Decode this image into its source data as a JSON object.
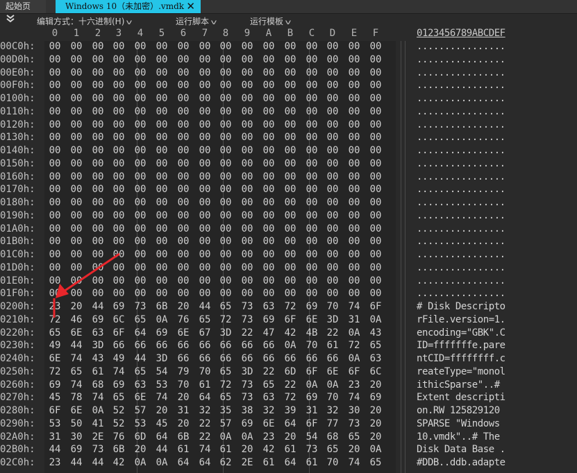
{
  "tabs": {
    "home_label": "起始页",
    "file_label": "Windows 10（未加密）.vmdk",
    "close_glyph": "✕"
  },
  "toolbar": {
    "edit_mode_label": "编辑方式：十六进制(H)",
    "run_script_label": "运行脚本",
    "run_template_label": "运行模板"
  },
  "columns": [
    "0",
    "1",
    "2",
    "3",
    "4",
    "5",
    "6",
    "7",
    "8",
    "9",
    "A",
    "B",
    "C",
    "D",
    "E",
    "F"
  ],
  "ascii_header": "0123456789ABCDEF",
  "rows": [
    {
      "offset": "00C0h:",
      "bytes": [
        "00",
        "00",
        "00",
        "00",
        "00",
        "00",
        "00",
        "00",
        "00",
        "00",
        "00",
        "00",
        "00",
        "00",
        "00",
        "00"
      ],
      "ascii": "................"
    },
    {
      "offset": "00D0h:",
      "bytes": [
        "00",
        "00",
        "00",
        "00",
        "00",
        "00",
        "00",
        "00",
        "00",
        "00",
        "00",
        "00",
        "00",
        "00",
        "00",
        "00"
      ],
      "ascii": "................"
    },
    {
      "offset": "00E0h:",
      "bytes": [
        "00",
        "00",
        "00",
        "00",
        "00",
        "00",
        "00",
        "00",
        "00",
        "00",
        "00",
        "00",
        "00",
        "00",
        "00",
        "00"
      ],
      "ascii": "................"
    },
    {
      "offset": "00F0h:",
      "bytes": [
        "00",
        "00",
        "00",
        "00",
        "00",
        "00",
        "00",
        "00",
        "00",
        "00",
        "00",
        "00",
        "00",
        "00",
        "00",
        "00"
      ],
      "ascii": "................"
    },
    {
      "offset": "0100h:",
      "bytes": [
        "00",
        "00",
        "00",
        "00",
        "00",
        "00",
        "00",
        "00",
        "00",
        "00",
        "00",
        "00",
        "00",
        "00",
        "00",
        "00"
      ],
      "ascii": "................"
    },
    {
      "offset": "0110h:",
      "bytes": [
        "00",
        "00",
        "00",
        "00",
        "00",
        "00",
        "00",
        "00",
        "00",
        "00",
        "00",
        "00",
        "00",
        "00",
        "00",
        "00"
      ],
      "ascii": "................"
    },
    {
      "offset": "0120h:",
      "bytes": [
        "00",
        "00",
        "00",
        "00",
        "00",
        "00",
        "00",
        "00",
        "00",
        "00",
        "00",
        "00",
        "00",
        "00",
        "00",
        "00"
      ],
      "ascii": "................"
    },
    {
      "offset": "0130h:",
      "bytes": [
        "00",
        "00",
        "00",
        "00",
        "00",
        "00",
        "00",
        "00",
        "00",
        "00",
        "00",
        "00",
        "00",
        "00",
        "00",
        "00"
      ],
      "ascii": "................"
    },
    {
      "offset": "0140h:",
      "bytes": [
        "00",
        "00",
        "00",
        "00",
        "00",
        "00",
        "00",
        "00",
        "00",
        "00",
        "00",
        "00",
        "00",
        "00",
        "00",
        "00"
      ],
      "ascii": "................"
    },
    {
      "offset": "0150h:",
      "bytes": [
        "00",
        "00",
        "00",
        "00",
        "00",
        "00",
        "00",
        "00",
        "00",
        "00",
        "00",
        "00",
        "00",
        "00",
        "00",
        "00"
      ],
      "ascii": "................"
    },
    {
      "offset": "0160h:",
      "bytes": [
        "00",
        "00",
        "00",
        "00",
        "00",
        "00",
        "00",
        "00",
        "00",
        "00",
        "00",
        "00",
        "00",
        "00",
        "00",
        "00"
      ],
      "ascii": "................"
    },
    {
      "offset": "0170h:",
      "bytes": [
        "00",
        "00",
        "00",
        "00",
        "00",
        "00",
        "00",
        "00",
        "00",
        "00",
        "00",
        "00",
        "00",
        "00",
        "00",
        "00"
      ],
      "ascii": "................"
    },
    {
      "offset": "0180h:",
      "bytes": [
        "00",
        "00",
        "00",
        "00",
        "00",
        "00",
        "00",
        "00",
        "00",
        "00",
        "00",
        "00",
        "00",
        "00",
        "00",
        "00"
      ],
      "ascii": "................"
    },
    {
      "offset": "0190h:",
      "bytes": [
        "00",
        "00",
        "00",
        "00",
        "00",
        "00",
        "00",
        "00",
        "00",
        "00",
        "00",
        "00",
        "00",
        "00",
        "00",
        "00"
      ],
      "ascii": "................"
    },
    {
      "offset": "01A0h:",
      "bytes": [
        "00",
        "00",
        "00",
        "00",
        "00",
        "00",
        "00",
        "00",
        "00",
        "00",
        "00",
        "00",
        "00",
        "00",
        "00",
        "00"
      ],
      "ascii": "................"
    },
    {
      "offset": "01B0h:",
      "bytes": [
        "00",
        "00",
        "00",
        "00",
        "00",
        "00",
        "00",
        "00",
        "00",
        "00",
        "00",
        "00",
        "00",
        "00",
        "00",
        "00"
      ],
      "ascii": "................"
    },
    {
      "offset": "01C0h:",
      "bytes": [
        "00",
        "00",
        "00",
        "00",
        "00",
        "00",
        "00",
        "00",
        "00",
        "00",
        "00",
        "00",
        "00",
        "00",
        "00",
        "00"
      ],
      "ascii": "................"
    },
    {
      "offset": "01D0h:",
      "bytes": [
        "00",
        "00",
        "00",
        "00",
        "00",
        "00",
        "00",
        "00",
        "00",
        "00",
        "00",
        "00",
        "00",
        "00",
        "00",
        "00"
      ],
      "ascii": "................"
    },
    {
      "offset": "01E0h:",
      "bytes": [
        "00",
        "00",
        "00",
        "00",
        "00",
        "00",
        "00",
        "00",
        "00",
        "00",
        "00",
        "00",
        "00",
        "00",
        "00",
        "00"
      ],
      "ascii": "................"
    },
    {
      "offset": "01F0h:",
      "bytes": [
        "00",
        "00",
        "00",
        "00",
        "00",
        "00",
        "00",
        "00",
        "00",
        "00",
        "00",
        "00",
        "00",
        "00",
        "00",
        "00"
      ],
      "ascii": "................"
    },
    {
      "offset": "0200h:",
      "bytes": [
        "23",
        "20",
        "44",
        "69",
        "73",
        "6B",
        "20",
        "44",
        "65",
        "73",
        "63",
        "72",
        "69",
        "70",
        "74",
        "6F"
      ],
      "ascii": "# Disk Descripto"
    },
    {
      "offset": "0210h:",
      "bytes": [
        "72",
        "46",
        "69",
        "6C",
        "65",
        "0A",
        "76",
        "65",
        "72",
        "73",
        "69",
        "6F",
        "6E",
        "3D",
        "31",
        "0A"
      ],
      "ascii": "rFile.version=1."
    },
    {
      "offset": "0220h:",
      "bytes": [
        "65",
        "6E",
        "63",
        "6F",
        "64",
        "69",
        "6E",
        "67",
        "3D",
        "22",
        "47",
        "42",
        "4B",
        "22",
        "0A",
        "43"
      ],
      "ascii": "encoding=\"GBK\".C"
    },
    {
      "offset": "0230h:",
      "bytes": [
        "49",
        "44",
        "3D",
        "66",
        "66",
        "66",
        "66",
        "66",
        "66",
        "66",
        "66",
        "0A",
        "70",
        "61",
        "72",
        "65"
      ],
      "ascii": "ID=fffffffe.pare"
    },
    {
      "offset": "0240h:",
      "bytes": [
        "6E",
        "74",
        "43",
        "49",
        "44",
        "3D",
        "66",
        "66",
        "66",
        "66",
        "66",
        "66",
        "66",
        "66",
        "0A",
        "63"
      ],
      "ascii": "ntCID=ffffffff.c"
    },
    {
      "offset": "0250h:",
      "bytes": [
        "72",
        "65",
        "61",
        "74",
        "65",
        "54",
        "79",
        "70",
        "65",
        "3D",
        "22",
        "6D",
        "6F",
        "6E",
        "6F",
        "6C"
      ],
      "ascii": "reateType=\"monol"
    },
    {
      "offset": "0260h:",
      "bytes": [
        "69",
        "74",
        "68",
        "69",
        "63",
        "53",
        "70",
        "61",
        "72",
        "73",
        "65",
        "22",
        "0A",
        "0A",
        "23",
        "20"
      ],
      "ascii": "ithicSparse\"..# "
    },
    {
      "offset": "0270h:",
      "bytes": [
        "45",
        "78",
        "74",
        "65",
        "6E",
        "74",
        "20",
        "64",
        "65",
        "73",
        "63",
        "72",
        "69",
        "70",
        "74",
        "69"
      ],
      "ascii": "Extent descripti"
    },
    {
      "offset": "0280h:",
      "bytes": [
        "6F",
        "6E",
        "0A",
        "52",
        "57",
        "20",
        "31",
        "32",
        "35",
        "38",
        "32",
        "39",
        "31",
        "32",
        "30",
        "20"
      ],
      "ascii": "on.RW 125829120 "
    },
    {
      "offset": "0290h:",
      "bytes": [
        "53",
        "50",
        "41",
        "52",
        "53",
        "45",
        "20",
        "22",
        "57",
        "69",
        "6E",
        "64",
        "6F",
        "77",
        "73",
        "20"
      ],
      "ascii": "SPARSE \"Windows "
    },
    {
      "offset": "02A0h:",
      "bytes": [
        "31",
        "30",
        "2E",
        "76",
        "6D",
        "64",
        "6B",
        "22",
        "0A",
        "0A",
        "23",
        "20",
        "54",
        "68",
        "65",
        "20"
      ],
      "ascii": "10.vmdk\"..# The "
    },
    {
      "offset": "02B0h:",
      "bytes": [
        "44",
        "69",
        "73",
        "6B",
        "20",
        "44",
        "61",
        "74",
        "61",
        "20",
        "42",
        "61",
        "73",
        "65",
        "20",
        "0A"
      ],
      "ascii": "Disk Data Base ."
    },
    {
      "offset": "02C0h:",
      "bytes": [
        "23",
        "44",
        "44",
        "42",
        "0A",
        "0A",
        "64",
        "64",
        "62",
        "2E",
        "61",
        "64",
        "61",
        "70",
        "74",
        "65"
      ],
      "ascii": "#DDB..ddb.adapte"
    }
  ],
  "colors": {
    "tab_active": "#25c5e8",
    "annotation": "#e8262b"
  }
}
